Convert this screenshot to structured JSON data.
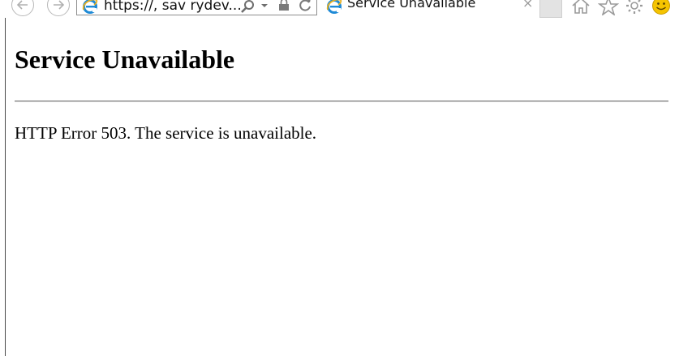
{
  "browser": {
    "address": {
      "url": "https://, sav  rydev..."
    },
    "tab": {
      "title": "Service Unavailable",
      "close_glyph": "×"
    },
    "icons": [
      "back-icon",
      "forward-icon",
      "ie-logo-icon",
      "search-icon",
      "dropdown-icon",
      "lock-icon",
      "refresh-icon",
      "home-icon",
      "favorites-star-icon",
      "settings-gear-icon",
      "smiley-feedback-icon"
    ]
  },
  "page": {
    "heading": "Service Unavailable",
    "message": "HTTP Error 503. The service is unavailable."
  },
  "colors": {
    "ie_blue": "#1e8ad6",
    "ie_gold": "#e8b020",
    "icon_gray": "#8a8a8a",
    "smiley_yellow": "#f5c400"
  }
}
